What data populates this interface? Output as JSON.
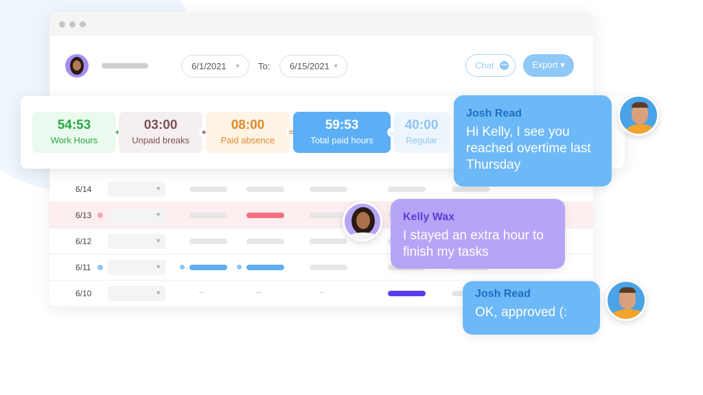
{
  "header": {
    "from_date": "6/1/2021",
    "to_label": "To:",
    "to_date": "6/15/2021",
    "chat_label": "Chat",
    "export_label": "Export ▾"
  },
  "summary": [
    {
      "value": "54:53",
      "label": "Work Hours",
      "op": "+",
      "color": "#2aa845",
      "bg": "#eafaee"
    },
    {
      "value": "03:00",
      "label": "Unpaid breaks",
      "op": "+",
      "color": "#7a4f58",
      "bg": "#f5efef"
    },
    {
      "value": "08:00",
      "label": "Paid absence",
      "op": "=",
      "color": "#d98a2a",
      "bg": "#fff3e6"
    },
    {
      "value": "59:53",
      "label": "Total paid hours",
      "op": "→",
      "color": "#ffffff",
      "bg": "#5caef5"
    },
    {
      "value": "40:00",
      "label": "Regular",
      "op": "",
      "color": "#8fc4f0",
      "bg": "#eef6fd"
    }
  ],
  "rows": [
    {
      "date": "6/14",
      "status": "none"
    },
    {
      "date": "6/13",
      "status": "alert"
    },
    {
      "date": "6/12",
      "status": "none"
    },
    {
      "date": "6/11",
      "status": "info"
    },
    {
      "date": "6/10",
      "status": "none"
    }
  ],
  "messages": [
    {
      "name": "Josh Read",
      "text": "Hi Kelly, I see you reached overtime last Thursday",
      "bg": "#6db8f7",
      "name_color": "#1e6fc4"
    },
    {
      "name": "Kelly Wax",
      "text": "I stayed an extra hour to finish my tasks",
      "bg": "#b6a5f7",
      "name_color": "#5a3fd6"
    },
    {
      "name": "Josh Read",
      "text": "OK, approved (:",
      "bg": "#6db8f7",
      "name_color": "#1e6fc4"
    }
  ],
  "colors": {
    "accent": "#5caef5",
    "alert": "#f4707e",
    "purple": "#5b3df0"
  }
}
